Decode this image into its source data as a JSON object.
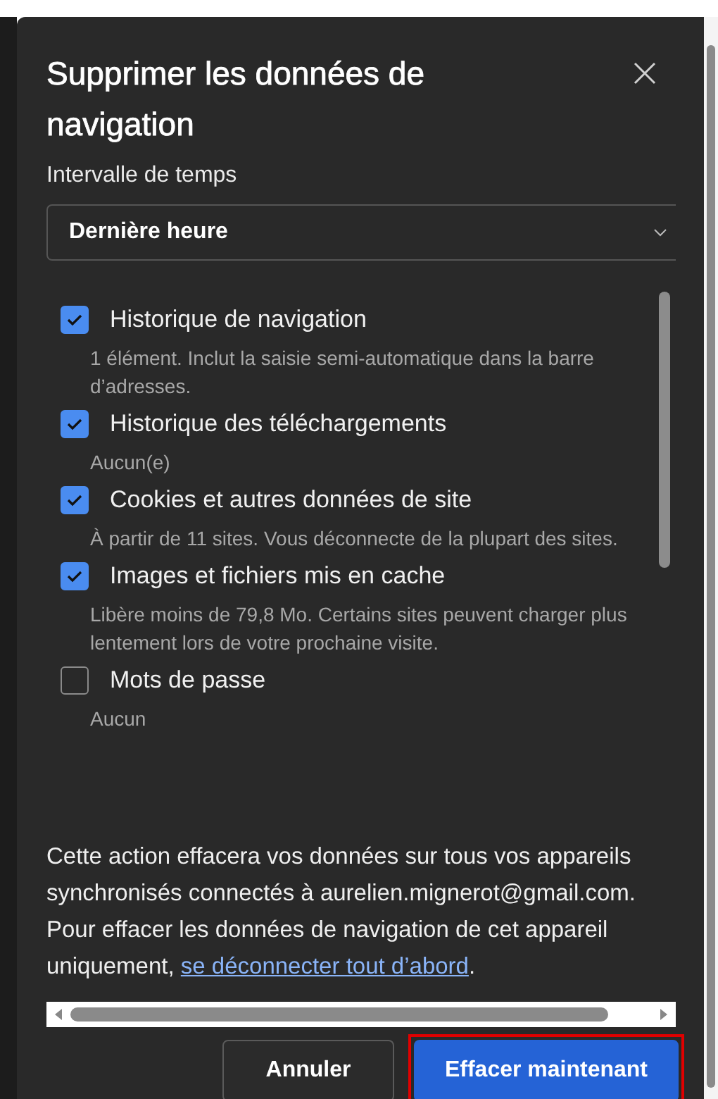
{
  "dialog": {
    "title": "Supprimer les données de navigation",
    "time_range": {
      "label": "Intervalle de temps",
      "value": "Dernière heure"
    },
    "options": [
      {
        "label": "Historique de navigation",
        "description": "1 élément. Inclut la saisie semi-automatique dans la barre d’adresses.",
        "checked": true
      },
      {
        "label": "Historique des téléchargements",
        "description": "Aucun(e)",
        "checked": true
      },
      {
        "label": "Cookies et autres données de site",
        "description": "À partir de 11 sites. Vous déconnecte de la plupart des sites.",
        "checked": true
      },
      {
        "label": "Images et fichiers mis en cache",
        "description": "Libère moins de 79,8 Mo. Certains sites peuvent charger plus lentement lors de votre prochaine visite.",
        "checked": true
      },
      {
        "label": "Mots de passe",
        "description": "Aucun",
        "checked": false
      }
    ],
    "notice": {
      "text": "Cette action effacera vos données sur tous vos appareils synchronisés connectés à aurelien.mignerot@gmail.com. Pour effacer les données de navigation de cet appareil uniquement, ",
      "link": "se déconnecter tout d’abord",
      "after": "."
    },
    "buttons": [
      {
        "label": "Annuler",
        "kind": "secondary",
        "highlighted": false
      },
      {
        "label": "Effacer maintenant",
        "kind": "primary",
        "highlighted": true
      }
    ]
  }
}
